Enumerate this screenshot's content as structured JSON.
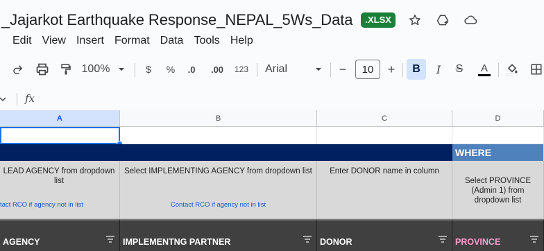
{
  "doc": {
    "title": "_Jajarkot Earthquake Response_NEPAL_5Ws_Data",
    "badge": ".XLSX"
  },
  "menu": [
    "Edit",
    "View",
    "Insert",
    "Format",
    "Data",
    "Tools",
    "Help"
  ],
  "toolbar": {
    "zoom": "100%",
    "currency": "$",
    "percent": "%",
    "dec_decrease": ".0",
    "dec_increase": ".00",
    "number_format": "123",
    "font": "Arial",
    "font_size": "10",
    "minus": "−",
    "plus": "+",
    "bold": "B",
    "italic": "I",
    "strike": "S",
    "text_color": "A"
  },
  "formula_bar": {
    "fx": "fx"
  },
  "columns": [
    "A",
    "B",
    "C",
    "D"
  ],
  "colors": {
    "band": "#002060",
    "where": "#4f81bd",
    "header": "#404040",
    "pink": "#ff9cce",
    "link": "#1155cc"
  },
  "sheet": {
    "where_label": "WHERE",
    "instructions": [
      {
        "main": "LEAD AGENCY from dropdown list",
        "link": "tact RCO if agency not in list"
      },
      {
        "main": "Select IMPLEMENTING AGENCY from dropdown list",
        "link": "Contact RCO if agency not in list"
      },
      {
        "main": "Enter DONOR name in column",
        "link": ""
      },
      {
        "main": "Select PROVINCE (Admin 1) from dropdown list",
        "link": ""
      }
    ],
    "headers": [
      "AGENCY",
      "IMPLEMENTNG PARTNER",
      "DONOR",
      "PROVINCE"
    ]
  }
}
